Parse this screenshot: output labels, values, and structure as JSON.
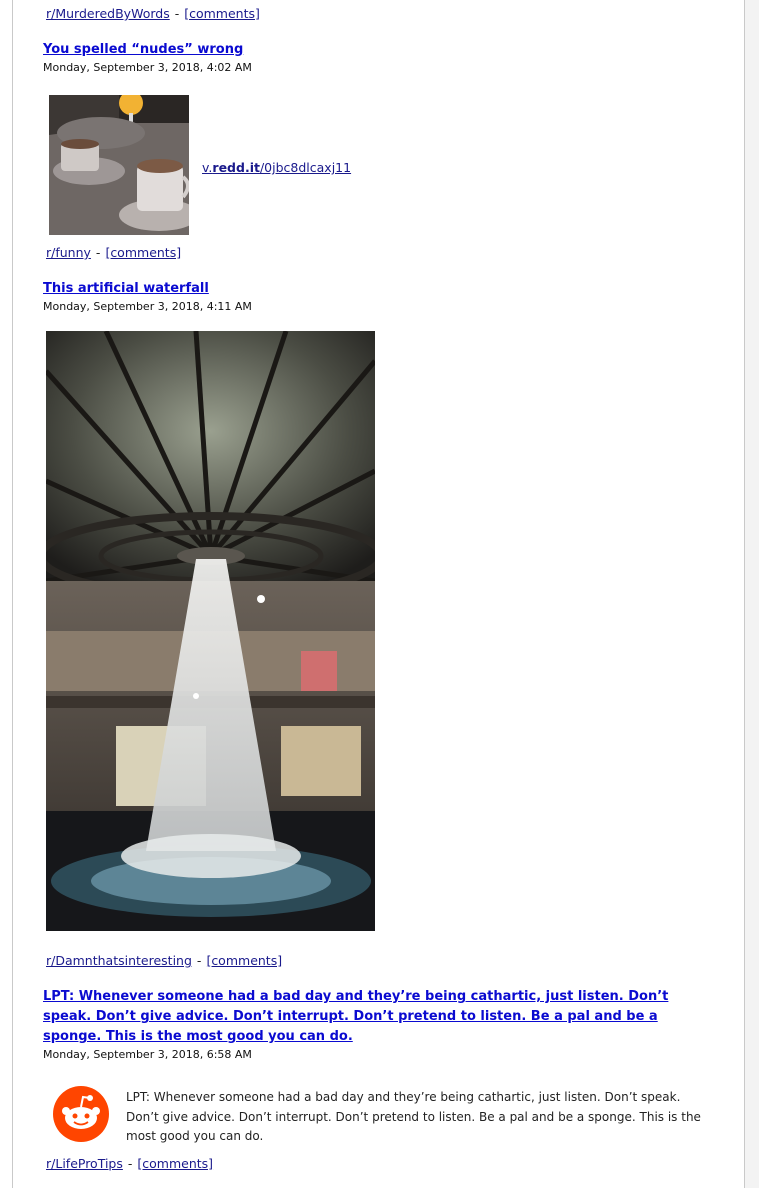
{
  "posts": [
    {
      "subreddit": "r/MurderedByWords",
      "comments": "[comments]"
    },
    {
      "title": "You spelled “nudes” wrong",
      "date": "Monday, September 3, 2018, 4:02 AM",
      "media_link_prefix": "v.",
      "media_link_domain": "redd.it",
      "media_link_path": "/0jbc8dlcaxj11",
      "subreddit": "r/funny",
      "comments": "[comments]"
    },
    {
      "title": "This artificial waterfall",
      "date": "Monday, September 3, 2018, 4:11 AM",
      "subreddit": "r/Damnthatsinteresting",
      "comments": "[comments]"
    },
    {
      "title": "LPT: Whenever someone had a bad day and they’re being cathartic, just listen. Don’t speak. Don’t give advice. Don’t interrupt. Don’t pretend to listen. Be a pal and be a sponge. This is the most good you can do.",
      "date": "Monday, September 3, 2018, 6:58 AM",
      "body": "LPT: Whenever someone had a bad day and they’re being cathartic, just listen. Don’t speak. Don’t give advice. Don’t interrupt. Don’t pretend to listen. Be a pal and be a sponge. This is the most good you can do.",
      "subreddit": "r/LifeProTips",
      "comments": "[comments]"
    }
  ],
  "separator": "-",
  "icons": {
    "reddit": "reddit-logo-icon"
  },
  "colors": {
    "link": "#1a0dab",
    "title": "#0a0ad0",
    "reddit_orange": "#ff4500"
  }
}
